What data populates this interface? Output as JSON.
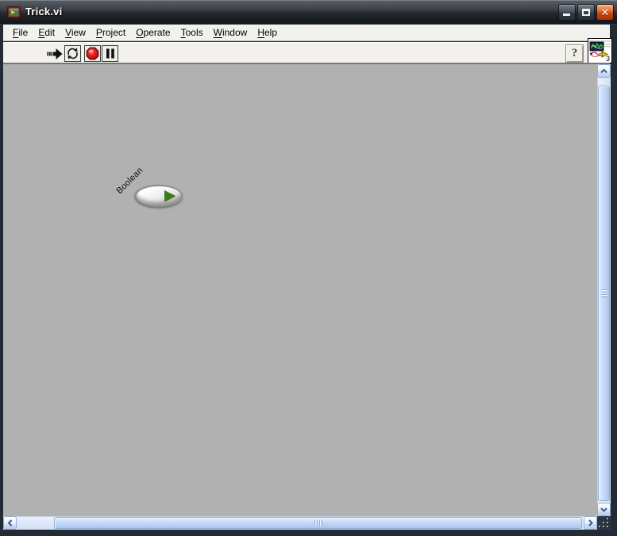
{
  "window": {
    "title": "Trick.vi",
    "app_icon": "labview-app-icon",
    "controls": [
      {
        "name": "minimize-button",
        "icon": "minimize-icon"
      },
      {
        "name": "maximize-button",
        "icon": "maximize-icon"
      },
      {
        "name": "close-button",
        "icon": "close-icon",
        "glyph": "✕",
        "color": "#cf4312"
      }
    ]
  },
  "menubar": {
    "items": [
      {
        "first": "F",
        "rest": "ile"
      },
      {
        "first": "E",
        "rest": "dit"
      },
      {
        "first": "V",
        "rest": "iew"
      },
      {
        "first": "P",
        "rest": "roject"
      },
      {
        "first": "O",
        "rest": "perate"
      },
      {
        "first": "T",
        "rest": "ools"
      },
      {
        "first": "W",
        "rest": "indow"
      },
      {
        "first": "H",
        "rest": "elp"
      }
    ]
  },
  "toolbar": {
    "buttons": [
      {
        "name": "run",
        "icon": "run-arrow-icon",
        "state": "running"
      },
      {
        "name": "run-continuously",
        "icon": "continuous-run-icon"
      },
      {
        "name": "abort-execution",
        "icon": "abort-stop-icon",
        "color": "#d01010"
      },
      {
        "name": "pause",
        "icon": "pause-icon"
      }
    ],
    "help_button_label": "?",
    "vi_icon": {
      "name": "vi-icon",
      "badge": "3"
    }
  },
  "panel": {
    "background_color": "#b1b1b1",
    "boolean_control": {
      "label": "Boolean",
      "state": "off",
      "accent_color": "#3c7a1e"
    }
  },
  "scrollbars": {
    "vertical": {
      "up_icon": "chevron-up-icon",
      "down_icon": "chevron-down-icon"
    },
    "horizontal": {
      "left_icon": "chevron-left-icon",
      "right_icon": "chevron-right-icon"
    },
    "accent_color": "#b8cff2"
  }
}
